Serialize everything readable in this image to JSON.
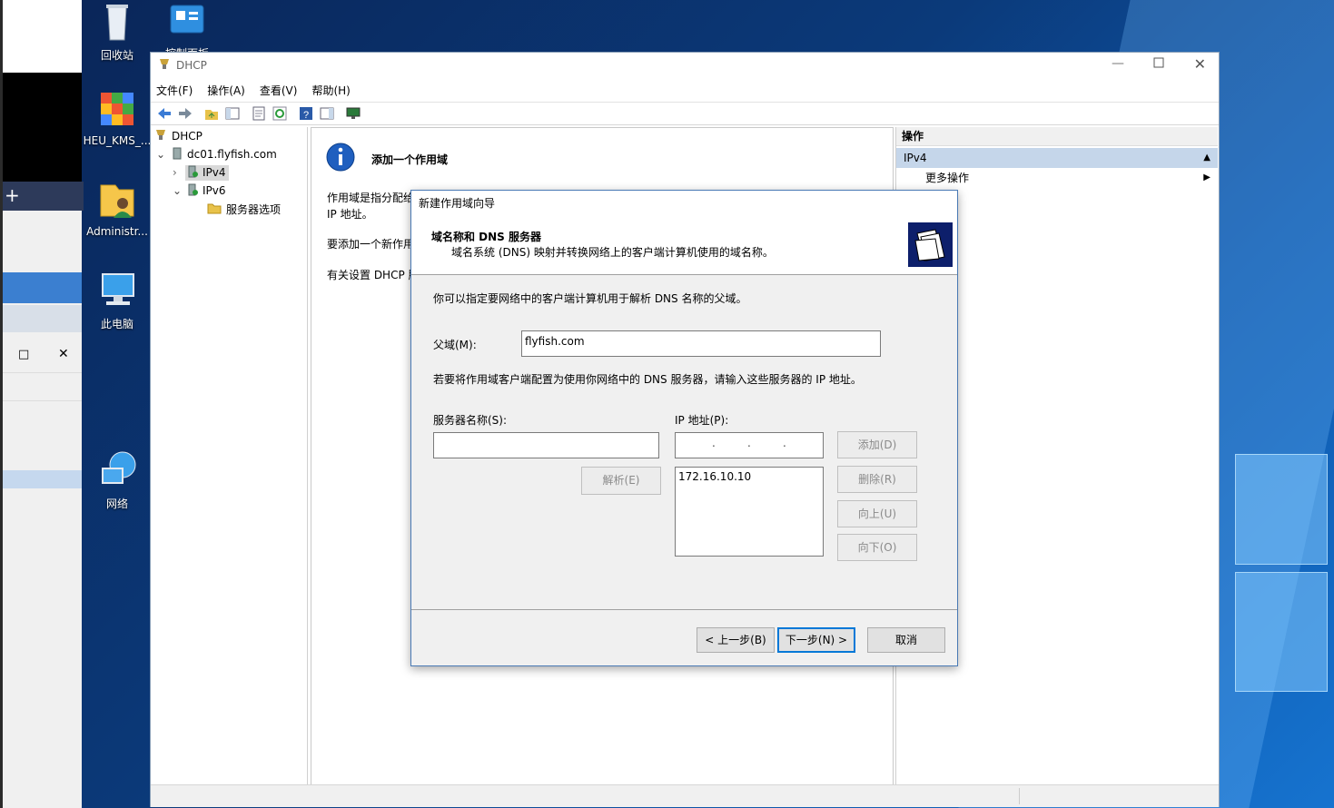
{
  "desktop": {
    "icons": [
      {
        "label": "回收站",
        "icon": "recycle-bin-icon"
      },
      {
        "label": "控制面板",
        "icon": "control-panel-icon"
      },
      {
        "label": "HEU_KMS_...",
        "icon": "kms-activator-icon"
      },
      {
        "label": "Administr...",
        "icon": "user-folder-icon"
      },
      {
        "label": "此电脑",
        "icon": "this-pc-icon"
      },
      {
        "label": "网络",
        "icon": "network-icon"
      }
    ]
  },
  "window": {
    "title": "DHCP",
    "menu": [
      "文件(F)",
      "操作(A)",
      "查看(V)",
      "帮助(H)"
    ],
    "tree": {
      "root": "DHCP",
      "server": "dc01.flyfish.com",
      "ipv4": "IPv4",
      "ipv6": "IPv6",
      "options": "服务器选项"
    },
    "center": {
      "heading": "添加一个作用域",
      "p1a": "作用域是指分配给",
      "p1b": "IP 地址。",
      "p2": "要添加一个新作用",
      "p3": "有关设置 DHCP 服"
    },
    "actions": {
      "header": "操作",
      "section": "IPv4",
      "more": "更多操作"
    }
  },
  "wizard": {
    "title": "新建作用域向导",
    "page_title": "域名称和 DNS 服务器",
    "page_subtitle": "域名系统 (DNS) 映射并转换网络上的客户端计算机使用的域名称。",
    "intro": "你可以指定要网络中的客户端计算机用于解析 DNS 名称的父域。",
    "parent_label": "父域(M):",
    "parent_value": "flyfish.com",
    "dns_note": "若要将作用域客户端配置为使用你网络中的 DNS 服务器，请输入这些服务器的 IP 地址。",
    "server_label": "服务器名称(S):",
    "ip_label": "IP 地址(P):",
    "ip_list": [
      "172.16.10.10"
    ],
    "buttons": {
      "add": "添加(D)",
      "resolve": "解析(E)",
      "remove": "删除(R)",
      "up": "向上(U)",
      "down": "向下(O)",
      "back": "< 上一步(B)",
      "next": "下一步(N) >",
      "cancel": "取消"
    }
  },
  "left_window": {
    "controls": [
      "□",
      "✕"
    ]
  }
}
